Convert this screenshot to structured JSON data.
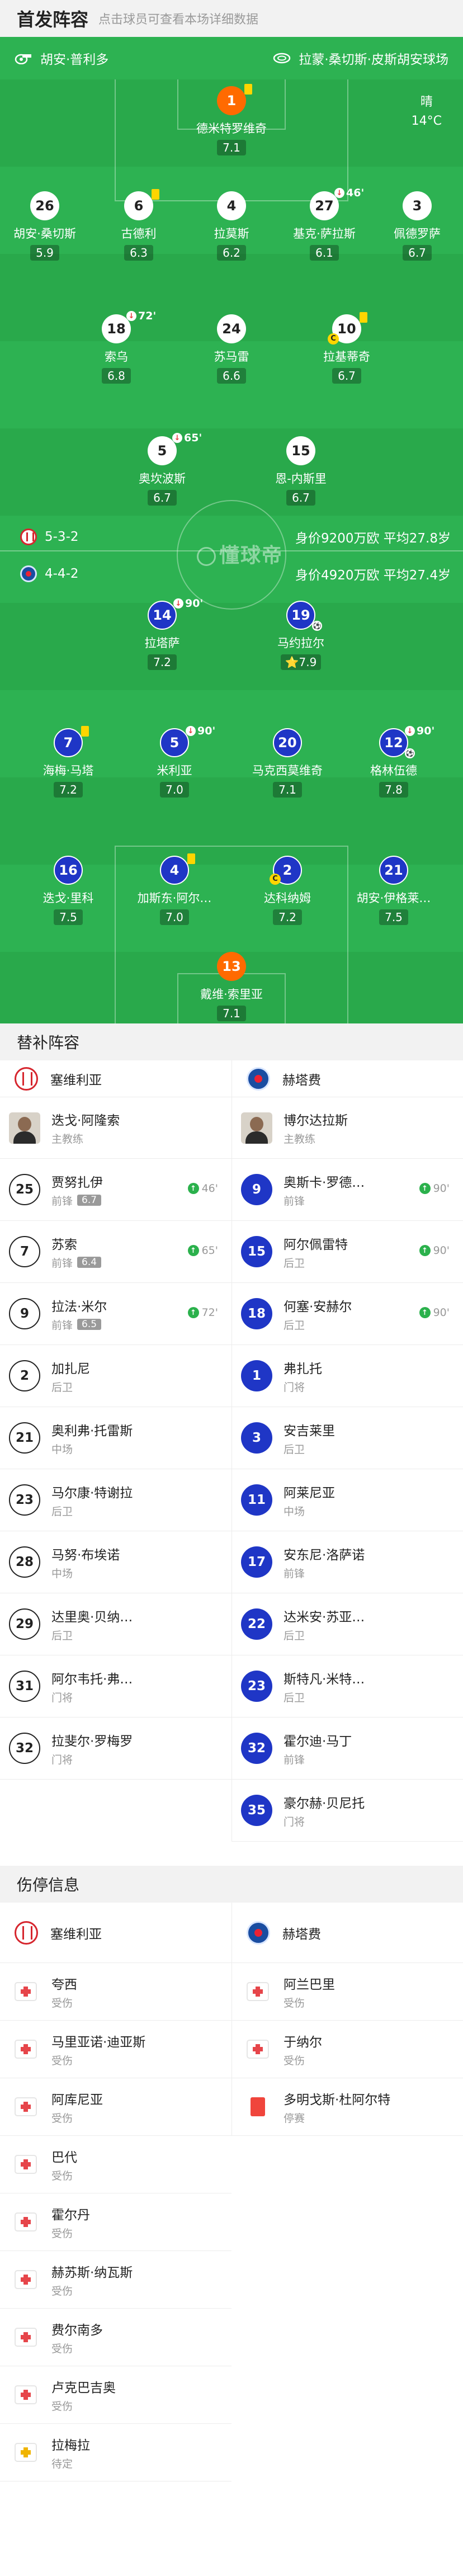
{
  "header": {
    "title": "首发阵容",
    "hint": "点击球员可查看本场详细数据"
  },
  "pitch": {
    "home_coach": "胡安·普利多",
    "away_coach": "拉蒙·桑切斯·皮斯胡安球场",
    "weather": "晴",
    "temperature": "14°C",
    "watermark": "懂球帝",
    "home_team_row": {
      "formation": "5-3-2",
      "stats": "身价9200万欧 平均27.8岁"
    },
    "away_team_row": {
      "formation": "4-4-2",
      "stats": "身价4920万欧 平均27.4岁"
    },
    "players": [
      {
        "num": "1",
        "name": "德米特罗维奇",
        "rating": "7.1"
      },
      {
        "num": "26",
        "name": "胡安·桑切斯",
        "rating": "5.9"
      },
      {
        "num": "6",
        "name": "古德利",
        "rating": "6.3"
      },
      {
        "num": "4",
        "name": "拉莫斯",
        "rating": "6.2"
      },
      {
        "num": "27",
        "name": "基克·萨拉斯",
        "rating": "6.1",
        "sub": "46'"
      },
      {
        "num": "3",
        "name": "佩德罗萨",
        "rating": "6.7"
      },
      {
        "num": "18",
        "name": "索乌",
        "rating": "6.8",
        "sub": "72'"
      },
      {
        "num": "24",
        "name": "苏马雷",
        "rating": "6.6"
      },
      {
        "num": "10",
        "name": "拉基蒂奇",
        "rating": "6.7"
      },
      {
        "num": "5",
        "name": "奥坎波斯",
        "rating": "6.7",
        "sub": "65'"
      },
      {
        "num": "15",
        "name": "恩-内斯里",
        "rating": "6.7"
      },
      {
        "num": "14",
        "name": "拉塔萨",
        "rating": "7.2",
        "sub": "90'"
      },
      {
        "num": "19",
        "name": "马约拉尔",
        "rating": "7.9"
      },
      {
        "num": "7",
        "name": "海梅·马塔",
        "rating": "7.2"
      },
      {
        "num": "5",
        "name": "米利亚",
        "rating": "7.0",
        "sub": "90'"
      },
      {
        "num": "20",
        "name": "马克西莫维奇",
        "rating": "7.1"
      },
      {
        "num": "12",
        "name": "格林伍德",
        "rating": "7.8",
        "sub": "90'"
      },
      {
        "num": "16",
        "name": "迭戈·里科",
        "rating": "7.5"
      },
      {
        "num": "4",
        "name": "加斯东·阿尔…",
        "rating": "7.0"
      },
      {
        "num": "2",
        "name": "达科纳姆",
        "rating": "7.2"
      },
      {
        "num": "21",
        "name": "胡安·伊格莱…",
        "rating": "7.5"
      },
      {
        "num": "13",
        "name": "戴维·索里亚",
        "rating": "7.1"
      }
    ]
  },
  "subs": {
    "section_title": "替补阵容",
    "home_team": "塞维利亚",
    "away_team": "赫塔费",
    "home": [
      {
        "name": "迭戈·阿隆索",
        "pos": "主教练",
        "coach": true
      },
      {
        "num": "25",
        "name": "贾努扎伊",
        "pos": "前锋",
        "rating": "6.7",
        "in": "46'"
      },
      {
        "num": "7",
        "name": "苏索",
        "pos": "前锋",
        "rating": "6.4",
        "in": "65'"
      },
      {
        "num": "9",
        "name": "拉法·米尔",
        "pos": "前锋",
        "rating": "6.5",
        "in": "72'"
      },
      {
        "num": "2",
        "name": "加扎尼",
        "pos": "后卫"
      },
      {
        "num": "21",
        "name": "奥利弗·托雷斯",
        "pos": "中场"
      },
      {
        "num": "23",
        "name": "马尔康·特谢拉",
        "pos": "后卫"
      },
      {
        "num": "28",
        "name": "马努·布埃诺",
        "pos": "中场"
      },
      {
        "num": "29",
        "name": "达里奥·贝纳…",
        "pos": "后卫"
      },
      {
        "num": "31",
        "name": "阿尔韦托·弗…",
        "pos": "门将"
      },
      {
        "num": "32",
        "name": "拉斐尔·罗梅罗",
        "pos": "门将"
      }
    ],
    "away": [
      {
        "name": "博尔达拉斯",
        "pos": "主教练",
        "coach": true
      },
      {
        "num": "9",
        "name": "奥斯卡·罗德…",
        "pos": "前锋",
        "in": "90'"
      },
      {
        "num": "15",
        "name": "阿尔佩雷特",
        "pos": "后卫",
        "in": "90'"
      },
      {
        "num": "18",
        "name": "何塞·安赫尔",
        "pos": "后卫",
        "in": "90'"
      },
      {
        "num": "1",
        "name": "弗扎托",
        "pos": "门将"
      },
      {
        "num": "3",
        "name": "安吉莱里",
        "pos": "后卫"
      },
      {
        "num": "11",
        "name": "阿莱尼亚",
        "pos": "中场"
      },
      {
        "num": "17",
        "name": "安东尼·洛萨诺",
        "pos": "前锋"
      },
      {
        "num": "22",
        "name": "达米安·苏亚…",
        "pos": "后卫"
      },
      {
        "num": "23",
        "name": "斯特凡·米特…",
        "pos": "后卫"
      },
      {
        "num": "32",
        "name": "霍尔迪·马丁",
        "pos": "前锋"
      },
      {
        "num": "35",
        "name": "豪尔赫·贝尼托",
        "pos": "门将"
      }
    ]
  },
  "injuries": {
    "section_title": "伤停信息",
    "home_team": "塞维利亚",
    "away_team": "赫塔费",
    "home": [
      {
        "name": "夸西",
        "status": "受伤",
        "icon": "medical-kit"
      },
      {
        "name": "马里亚诺·迪亚斯",
        "status": "受伤",
        "icon": "medical-kit"
      },
      {
        "name": "阿库尼亚",
        "status": "受伤",
        "icon": "medical-kit"
      },
      {
        "name": "巴代",
        "status": "受伤",
        "icon": "medical-kit"
      },
      {
        "name": "霍尔丹",
        "status": "受伤",
        "icon": "medical-kit"
      },
      {
        "name": "赫苏斯·纳瓦斯",
        "status": "受伤",
        "icon": "medical-kit"
      },
      {
        "name": "费尔南多",
        "status": "受伤",
        "icon": "medical-kit"
      },
      {
        "name": "卢克巴吉奥",
        "status": "受伤",
        "icon": "medical-kit"
      },
      {
        "name": "拉梅拉",
        "status": "待定",
        "icon": "medical-kit-yellow"
      }
    ],
    "away": [
      {
        "name": "阿兰巴里",
        "status": "受伤",
        "icon": "medical-kit"
      },
      {
        "name": "于纳尔",
        "status": "受伤",
        "icon": "medical-kit"
      },
      {
        "name": "多明戈斯·杜阿尔特",
        "status": "停赛",
        "icon": "red-card"
      }
    ]
  },
  "colors": {
    "pitch": "#2db252",
    "home": "#ffffff",
    "away": "#1f36c6",
    "goalkeeper": "#ff6a00",
    "yellow_card": "#ffd500",
    "sub_in": "#2bb14c",
    "sub_out": "#e73d3d"
  }
}
